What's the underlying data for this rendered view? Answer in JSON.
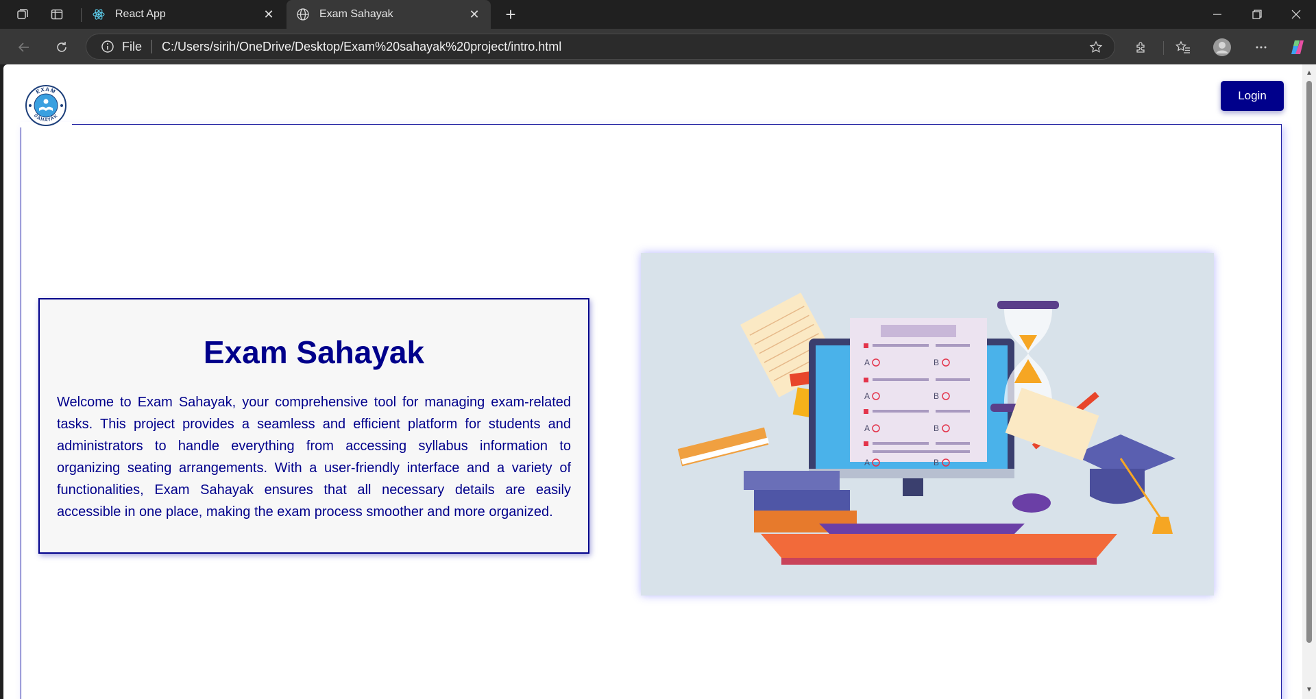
{
  "browser": {
    "tabs": [
      {
        "title": "React App",
        "icon": "react-icon",
        "active": false
      },
      {
        "title": "Exam Sahayak",
        "icon": "globe-icon",
        "active": true
      }
    ],
    "address": {
      "scheme_label": "File",
      "url": "C:/Users/sirih/OneDrive/Desktop/Exam%20sahayak%20project/intro.html"
    },
    "colors": {
      "frame": "#202020",
      "toolbar": "#383838",
      "address_bg": "#2b2b2b"
    }
  },
  "page": {
    "login_label": "Login",
    "logo": {
      "top_text": "EXAM",
      "bottom_text": "SAHAYAK"
    },
    "heading": "Exam Sahayak",
    "description": "Welcome to Exam Sahayak, your comprehensive tool for managing exam-related tasks. This project provides a seamless and efficient platform for students and administrators to handle everything from accessing syllabus information to organizing seating arrangements. With a user-friendly interface and a variety of functionalities, Exam Sahayak ensures that all necessary details are easily accessible in one place, making the exam process smoother and more organized.",
    "illustration": {
      "options": [
        "A",
        "B",
        "A",
        "B",
        "A",
        "B",
        "A",
        "B"
      ]
    },
    "colors": {
      "accent": "#00008b",
      "panel": "#f7f7f7",
      "illustration_bg": "#d8e2ea"
    }
  }
}
